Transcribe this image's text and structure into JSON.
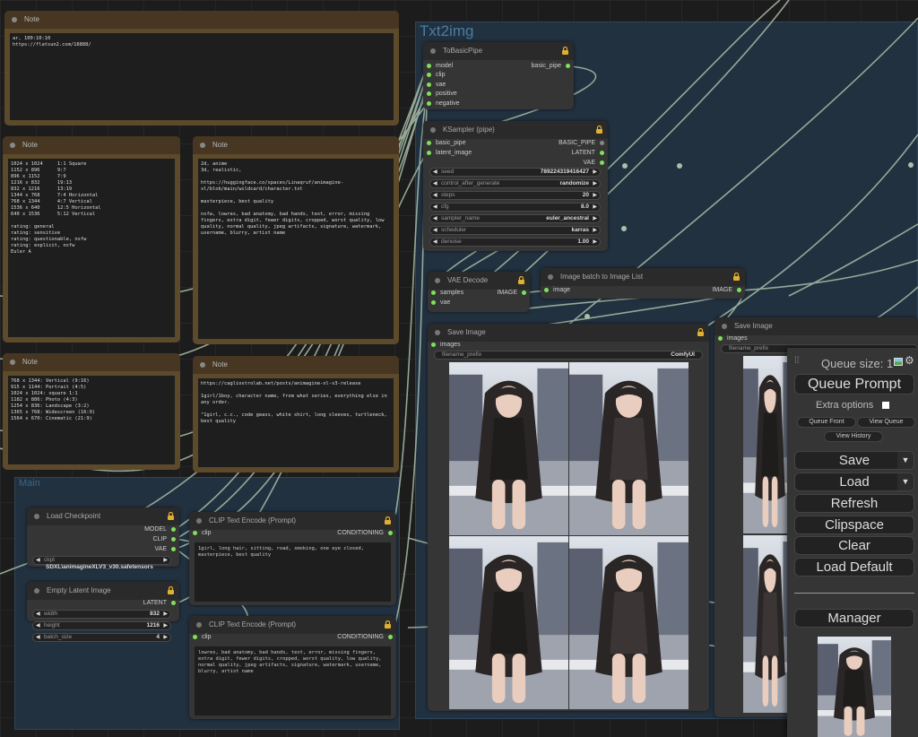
{
  "groups": {
    "txt2img_title": "Txt2img",
    "main_title": "Main"
  },
  "notes": [
    {
      "title": "Note",
      "text": "ar, 100:10:10\nhttps://flatsun2.com/18888/"
    },
    {
      "title": "Note",
      "text": "1024 x 1024     1:1 Square\n1152 x 896      9:7\n896 x 1152      7:9\n1216 x 832      19:13\n832 x 1216      13:19\n1344 x 768      7:4 Horizontal\n768 x 1344      4:7 Vertical\n1536 x 640      12:5 Horizontal\n640 x 1536      5:12 Vertical\n\nrating: general\nrating: sensitive\nrating: questionable, nsfw\nrating: explicit, nsfw\nEuler A"
    },
    {
      "title": "Note",
      "text": "2d, anime\n3d, realistic,\n\nhttps://huggingface.co/spaces/Linaqruf/animagine-xl/blob/main/wildcard/character.txt\n\nmasterpiece, best quality\n\nnsfw, lowres, bad anatomy, bad hands, text, error, missing fingers, extra digit, fewer digits, cropped, worst quality, low quality, normal quality, jpeg artifacts, signature, watermark, username, blurry, artist name"
    },
    {
      "title": "Note",
      "text": "768 x 1344: Vertical (9:16)\n915 x 1144: Portrait (4:5)\n1024 x 1024: square 1:1\n1182 x 886: Photo (4:3)\n1254 x 836: Landscape (3:2)\n1365 x 768: Widescreen (16:9)\n1564 x 670: Cinematic (21:9)"
    },
    {
      "title": "Note",
      "text": "https://cagliostrolab.net/posts/animagine-xl-v3-release\n\n1girl/1boy, character name, from what series, everything else in any order.\n\n\"1girl, c.c., code geass, white shirt, long sleeves, turtleneck, best quality"
    }
  ],
  "to_basic_pipe": {
    "title": "ToBasicPipe",
    "inputs": [
      "model",
      "clip",
      "vae",
      "positive",
      "negative"
    ],
    "output": "basic_pipe"
  },
  "ksampler": {
    "title": "KSampler (pipe)",
    "inputs": [
      "basic_pipe",
      "latent_image"
    ],
    "outputs": [
      "BASIC_PIPE",
      "LATENT",
      "VAE"
    ],
    "widgets": [
      {
        "label": "seed",
        "value": "789224319416427"
      },
      {
        "label": "control_after_generate",
        "value": "randomize"
      },
      {
        "label": "steps",
        "value": "20"
      },
      {
        "label": "cfg",
        "value": "8.0"
      },
      {
        "label": "sampler_name",
        "value": "euler_ancestral"
      },
      {
        "label": "scheduler",
        "value": "karras"
      },
      {
        "label": "denoise",
        "value": "1.00"
      }
    ]
  },
  "vae_decode": {
    "title": "VAE Decode",
    "inputs": [
      "samples",
      "vae"
    ],
    "output": "IMAGE"
  },
  "batch_to_list": {
    "title": "Image batch to Image List",
    "input": "image",
    "output": "IMAGE"
  },
  "save_image_1": {
    "title": "Save Image",
    "input": "images",
    "widget_label": "filename_prefix",
    "widget_value": "ComfyUI"
  },
  "save_image_2": {
    "title": "Save Image",
    "input": "images",
    "widget_label": "filename_prefix"
  },
  "load_checkpoint": {
    "title": "Load Checkpoint",
    "outputs": [
      "MODEL",
      "CLIP",
      "VAE"
    ],
    "widget_label": "ckpt",
    "widget_value": "SDXL\\animagineXLV3_v30.safetensors"
  },
  "empty_latent": {
    "title": "Empty Latent Image",
    "output": "LATENT",
    "widgets": [
      {
        "label": "width",
        "value": "832"
      },
      {
        "label": "height",
        "value": "1216"
      },
      {
        "label": "batch_size",
        "value": "4"
      }
    ]
  },
  "clip_pos": {
    "title": "CLIP Text Encode (Prompt)",
    "input": "clip",
    "output": "CONDITIONING",
    "text": "1girl, long hair, sitting, road, smoking, one eye closed, masterpiece, best quality"
  },
  "clip_neg": {
    "title": "CLIP Text Encode (Prompt)",
    "input": "clip",
    "output": "CONDITIONING",
    "text": "lowres, bad anatomy, bad hands, text, error, missing fingers, extra digit, fewer digits, cropped, worst quality, low quality, normal quality, jpeg artifacts, signature, watermark, username, blurry, artist name"
  },
  "menu": {
    "queue_size_label": "Queue size: 1",
    "queue_prompt": "Queue Prompt",
    "extra_options": "Extra options",
    "queue_front": "Queue Front",
    "view_queue": "View Queue",
    "view_history": "View History",
    "save": "Save",
    "load": "Load",
    "refresh": "Refresh",
    "clipspace": "Clipspace",
    "clear": "Clear",
    "load_default": "Load Default",
    "manager": "Manager"
  },
  "colors": {
    "slot_connected": "#7ee05b",
    "lock": "#e0b030",
    "group_bg": "#223140",
    "note_border": "#5c4a2a"
  }
}
